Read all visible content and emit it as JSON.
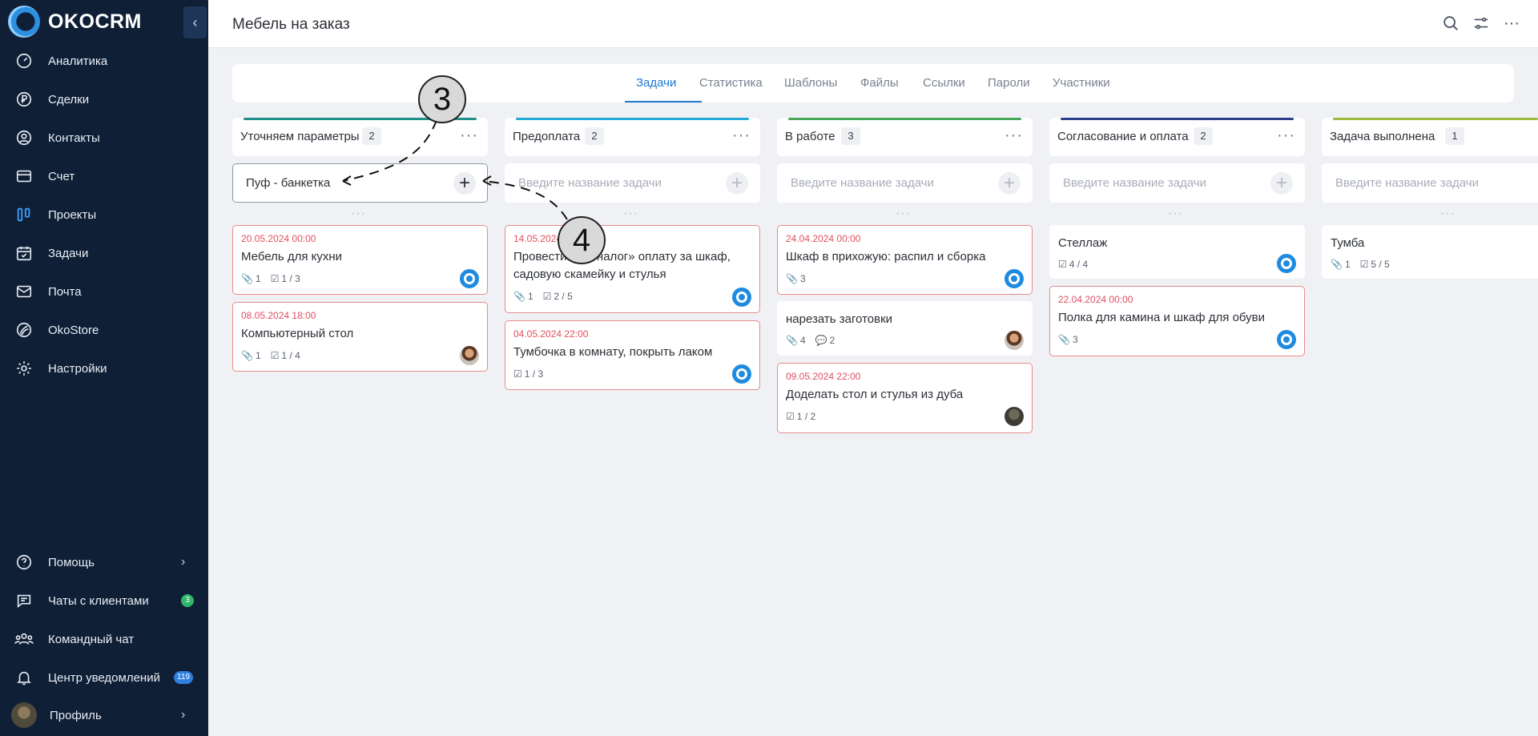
{
  "app": {
    "logo_text": "OKOCRM",
    "collapse_icon": "chevron-left-icon"
  },
  "sidebar": {
    "items": [
      {
        "label": "Аналитика",
        "icon": "gauge-icon"
      },
      {
        "label": "Сделки",
        "icon": "ruble-icon"
      },
      {
        "label": "Контакты",
        "icon": "user-circle-icon"
      },
      {
        "label": "Счет",
        "icon": "invoice-icon"
      },
      {
        "label": "Проекты",
        "icon": "columns-icon"
      },
      {
        "label": "Задачи",
        "icon": "calendar-check-icon"
      },
      {
        "label": "Почта",
        "icon": "mail-icon"
      },
      {
        "label": "OkoStore",
        "icon": "store-icon"
      },
      {
        "label": "Настройки",
        "icon": "gear-icon"
      }
    ],
    "bottom_items": [
      {
        "label": "Помощь",
        "icon": "help-icon"
      },
      {
        "label": "Чаты с клиентами",
        "icon": "chat-icon",
        "badge": "3"
      },
      {
        "label": "Командный чат",
        "icon": "team-icon"
      },
      {
        "label": "Центр уведомлений",
        "icon": "bell-icon",
        "badge": "119"
      },
      {
        "label": "Профиль",
        "icon": "avatar"
      }
    ]
  },
  "header": {
    "title": "Мебель на заказ",
    "icons": [
      "search-icon",
      "filter-sliders-icon",
      "more-horizontal-icon"
    ]
  },
  "tabs": [
    {
      "label": "Задачи",
      "active": true
    },
    {
      "label": "Статистика"
    },
    {
      "label": "Шаблоны"
    },
    {
      "label": "Файлы"
    },
    {
      "label": "Ссылки"
    },
    {
      "label": "Пароли"
    },
    {
      "label": "Участники"
    }
  ],
  "board": {
    "new_task_placeholder": "Введите название задачи",
    "columns": [
      {
        "title": "Уточняем параметры",
        "count": "2",
        "color": "#1f8f8a",
        "new_task_value": "Пуф - банкетка",
        "cards": [
          {
            "due": "20.05.2024 00:00",
            "title": "Мебель для кухни",
            "attachments": "1",
            "checklist": "1 / 3",
            "assignee": "blue",
            "overdue": true
          },
          {
            "due": "08.05.2024 18:00",
            "title": "Компьютерный стол",
            "attachments": "1",
            "checklist": "1 / 4",
            "assignee": "photo1",
            "overdue": true
          }
        ]
      },
      {
        "title": "Предоплата",
        "count": "2",
        "color": "#22a9d6",
        "new_task_value": "",
        "cards": [
          {
            "due": "14.05.2024",
            "title_line1": "Провести «...й налог» оплату за шкаф,",
            "title_line2": "садовую скамейку и стулья",
            "attachments": "1",
            "checklist": "2 / 5",
            "assignee": "blue",
            "overdue": true
          },
          {
            "due": "04.05.2024 22:00",
            "title": "Тумбочка в комнату, покрыть лаком",
            "checklist": "1 / 3",
            "assignee": "blue",
            "overdue": true
          }
        ]
      },
      {
        "title": "В работе",
        "count": "3",
        "color": "#47a85a",
        "new_task_value": "",
        "cards": [
          {
            "due": "24.04.2024 00:00",
            "title": "Шкаф в прихожую: распил и сборка",
            "attachments": "3",
            "assignee": "blue",
            "overdue": true
          },
          {
            "title": "нарезать заготовки",
            "attachments": "4",
            "comments": "2",
            "assignee": "photo1",
            "overdue": false
          },
          {
            "due": "09.05.2024 22:00",
            "title": "Доделать стол и стулья из дуба",
            "checklist": "1 / 2",
            "assignee": "photo2",
            "overdue": true
          }
        ]
      },
      {
        "title": "Согласование и оплата",
        "count": "2",
        "color": "#2c3f8c",
        "new_task_value": "",
        "cards": [
          {
            "title": "Стеллаж",
            "checklist": "4 / 4",
            "assignee": "blue",
            "overdue": false
          },
          {
            "due": "22.04.2024 00:00",
            "title": "Полка для камина и шкаф для обуви",
            "attachments": "3",
            "assignee": "blue",
            "overdue": true
          }
        ]
      },
      {
        "title": "Задача выполнена",
        "count": "1",
        "color": "#9dbb3a",
        "new_task_value": "",
        "cards": [
          {
            "title": "Тумба",
            "attachments": "1",
            "checklist": "5 / 5",
            "overdue": false
          }
        ]
      }
    ]
  },
  "annotations": [
    "3",
    "4"
  ]
}
